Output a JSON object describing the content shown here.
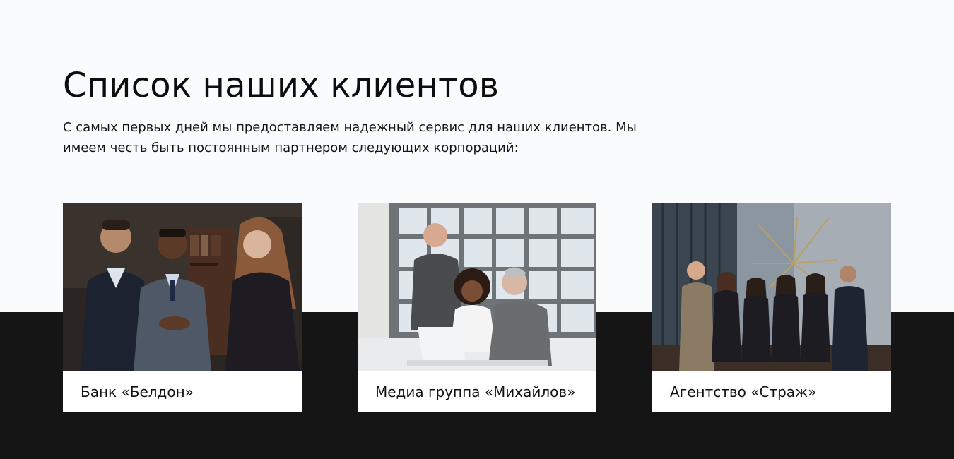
{
  "section": {
    "title": "Список наших клиентов",
    "description": "С самых первых дней мы предоставляем надежный сервис для наших клиентов. Мы имеем честь быть постоянным партнером следующих корпораций:"
  },
  "clients": [
    {
      "name": "Банк «Белдон»"
    },
    {
      "name": "Медиа группа «Михайлов»"
    },
    {
      "name": "Агентство «Страж»"
    }
  ],
  "colors": {
    "page_background": "#fafbfd",
    "band_background": "#151515",
    "card_background": "#ffffff"
  }
}
